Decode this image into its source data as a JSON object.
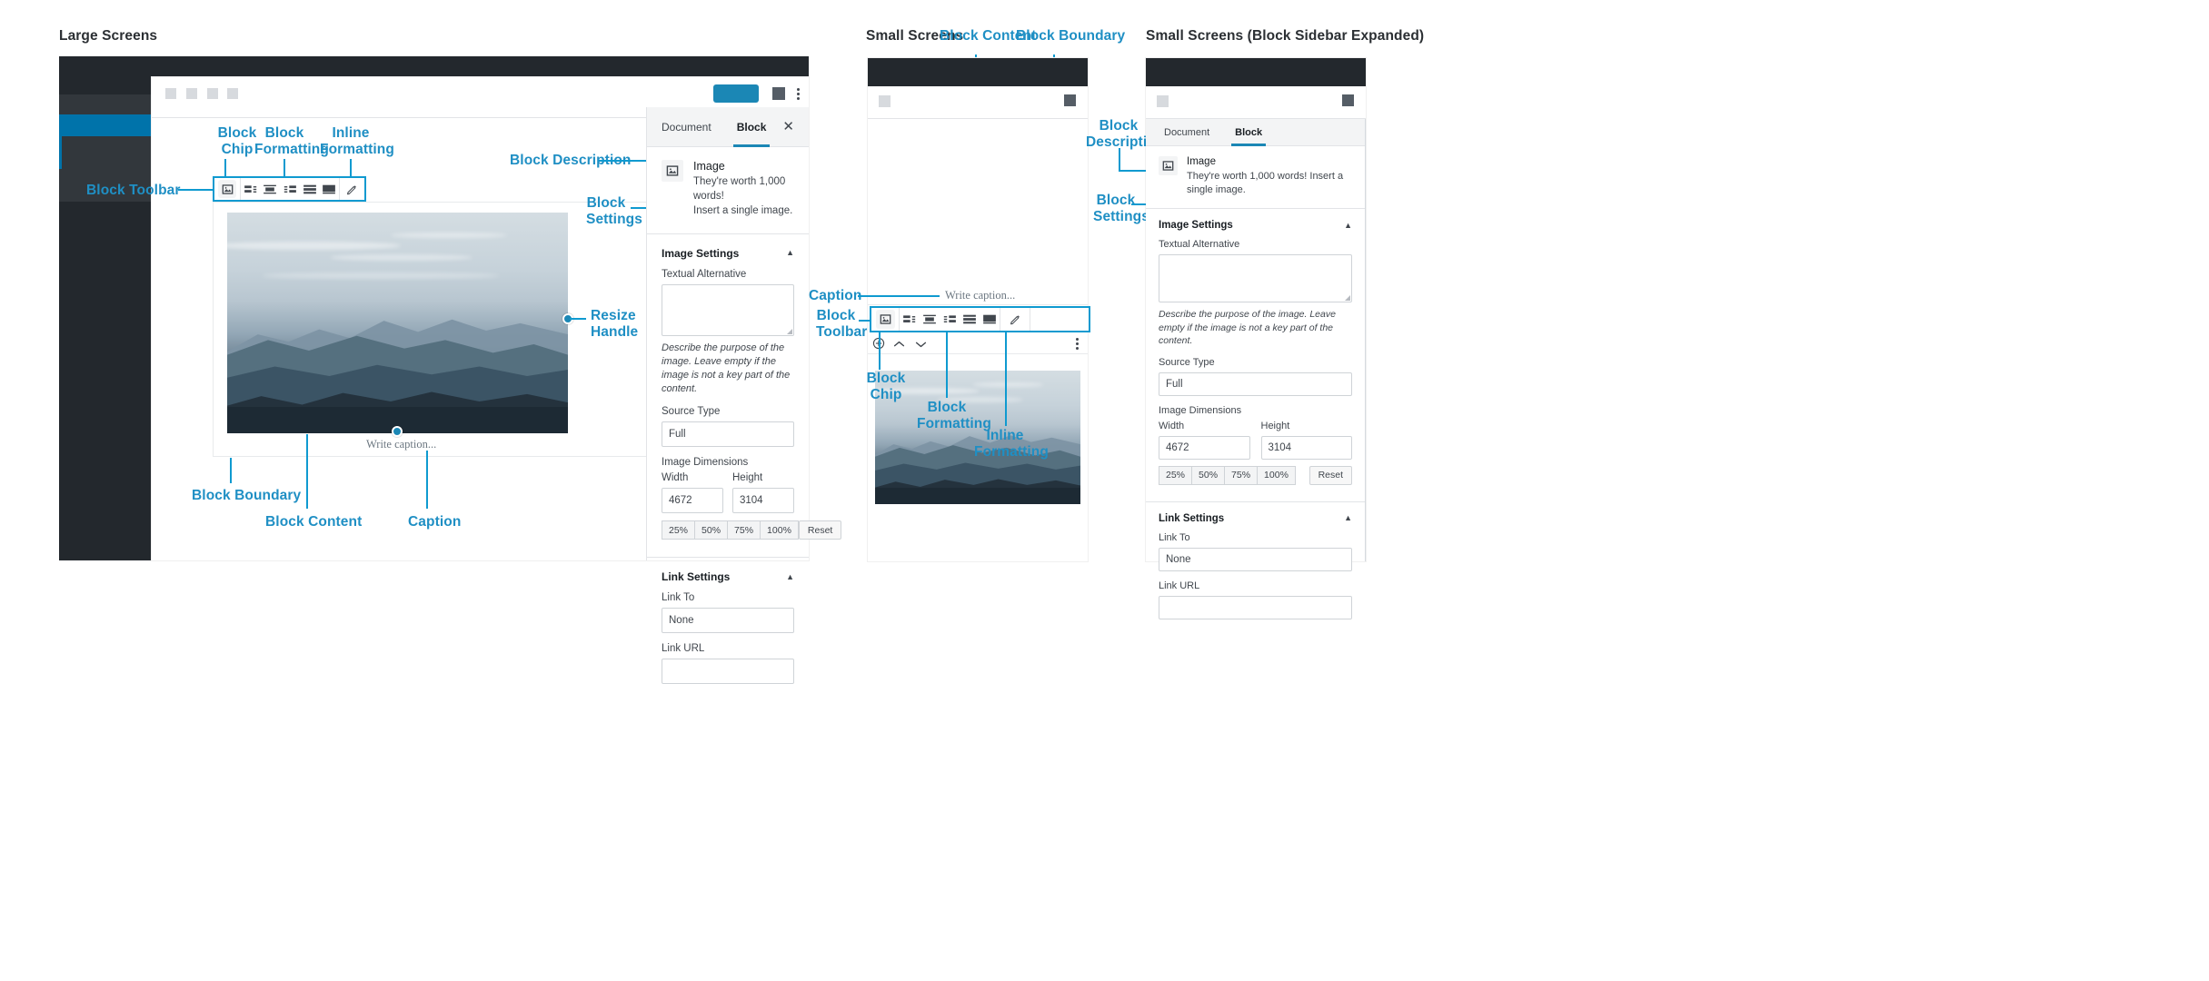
{
  "sections": {
    "large": "Large Screens",
    "small": "Small Screens",
    "small_expanded": "Small Screens (Block Sidebar Expanded)"
  },
  "annotations": {
    "block_chip": "Block\nChip",
    "block_formatting": "Block\nFormatting",
    "inline_formatting": "Inline\nFormatting",
    "block_toolbar": "Block Toolbar",
    "block_toolbar_2": "Block\nToolbar",
    "block_description": "Block Description",
    "block_description_2": "Block\nDescription",
    "block_settings": "Block\nSettings",
    "resize_handle": "Resize\nHandle",
    "block_boundary": "Block Boundary",
    "block_content": "Block Content",
    "caption": "Caption"
  },
  "panel": {
    "tabs": [
      {
        "label": "Document",
        "active": false
      },
      {
        "label": "Block",
        "active": true
      }
    ],
    "close_icon": "close-icon",
    "block": {
      "icon": "image-block-icon",
      "title": "Image",
      "description_lines": [
        "They're worth 1,000 words!",
        "Insert a single image."
      ],
      "description_inline": "They're worth 1,000 words! Insert a single image."
    },
    "image_settings": {
      "heading": "Image Settings",
      "collapse_icon": "caret-up-icon",
      "textual_alternative_label": "Textual Alternative",
      "textual_alternative_value": "",
      "help_text": "Describe the purpose of the image. Leave empty if the image is not a key part of the content.",
      "source_type_label": "Source Type",
      "source_type_value": "Full",
      "dimensions_label": "Image Dimensions",
      "width_label": "Width",
      "width_value": "4672",
      "height_label": "Height",
      "height_value": "3104",
      "scale_buttons": [
        "25%",
        "50%",
        "75%",
        "100%"
      ],
      "reset_label": "Reset"
    },
    "link_settings": {
      "heading": "Link Settings",
      "collapse_icon": "caret-up-icon",
      "link_to_label": "Link To",
      "link_to_value": "None",
      "link_url_label": "Link URL",
      "link_url_value": ""
    }
  },
  "editor": {
    "caption_placeholder": "Write caption...",
    "toolbar_icons": [
      "image-block-chip-icon",
      "align-left-icon",
      "align-center-icon",
      "align-right-icon",
      "align-wide-icon",
      "align-full-icon",
      "edit-pencil-icon"
    ],
    "mobile_nav_icons": [
      "add-block-icon",
      "move-up-icon",
      "move-down-icon",
      "more-options-icon"
    ]
  }
}
